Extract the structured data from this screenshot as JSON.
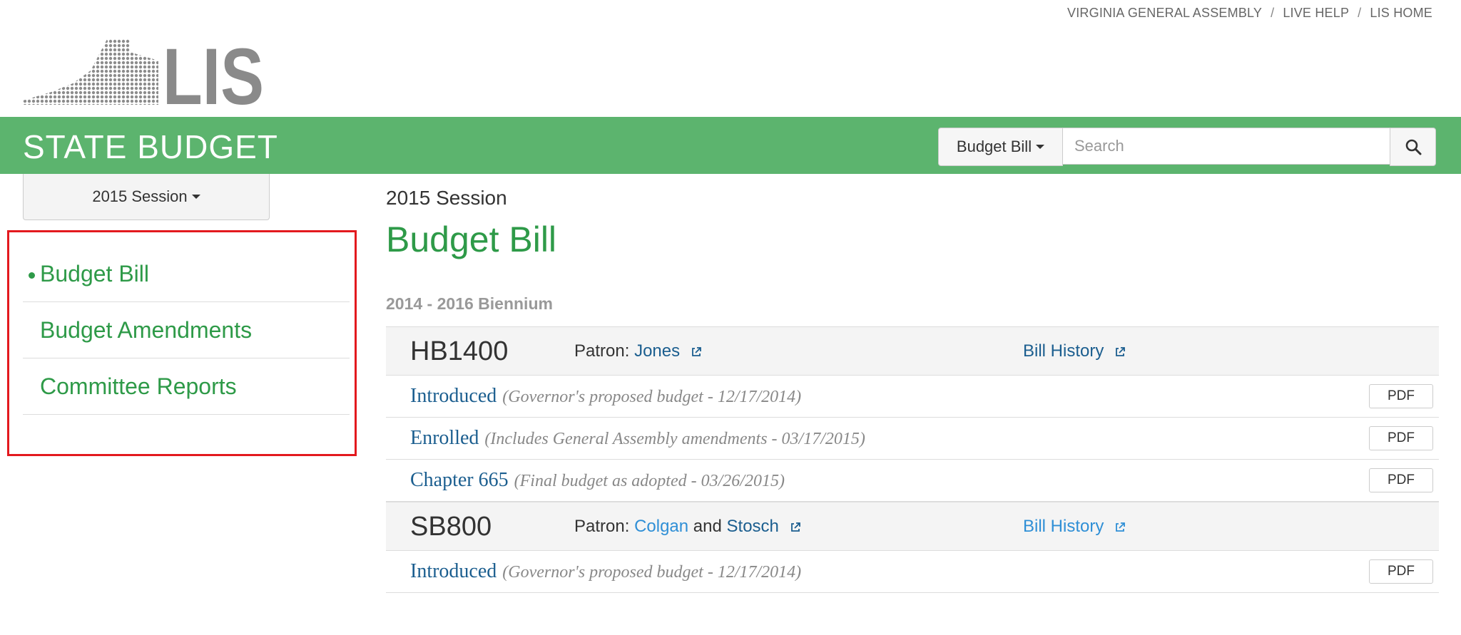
{
  "top_links": [
    "VIRGINIA GENERAL ASSEMBLY",
    "LIVE HELP",
    "LIS HOME"
  ],
  "top_separator": "/",
  "logo_text": "LIS",
  "header": {
    "title": "STATE BUDGET",
    "search_type": "Budget Bill",
    "search_placeholder": "Search",
    "background_color": "#5cb46e"
  },
  "sidebar": {
    "session_button": "2015 Session",
    "items": [
      {
        "label": "Budget Bill",
        "active": true
      },
      {
        "label": "Budget Amendments",
        "active": false
      },
      {
        "label": "Committee Reports",
        "active": false
      }
    ],
    "highlight_color": "#e3191e"
  },
  "main": {
    "session_label": "2015 Session",
    "title": "Budget Bill",
    "biennium": "2014 - 2016 Biennium",
    "bills": [
      {
        "number": "HB1400",
        "patron_label": "Patron:",
        "patron_name": "Jones",
        "bill_history": "Bill History",
        "versions": [
          {
            "name": "Introduced",
            "desc": "(Governor's proposed budget - 12/17/2014)",
            "pdf": "PDF"
          },
          {
            "name": "Enrolled",
            "desc": "(Includes General Assembly amendments - 03/17/2015)",
            "pdf": "PDF"
          },
          {
            "name": "Chapter 665",
            "desc": "(Final budget as adopted - 03/26/2015)",
            "pdf": "PDF"
          }
        ]
      },
      {
        "number": "SB800",
        "patron_label": "Patron:",
        "patron_name_1": "Colgan",
        "patron_and": "and",
        "patron_name_2": "Stosch",
        "bill_history": "Bill History",
        "versions": [
          {
            "name": "Introduced",
            "desc": "(Governor's proposed budget - 12/17/2014)",
            "pdf": "PDF"
          }
        ]
      }
    ]
  },
  "colors": {
    "accent_green": "#2e9a48",
    "link_blue": "#1b5e8f",
    "link_light_blue": "#2f8fd6"
  }
}
